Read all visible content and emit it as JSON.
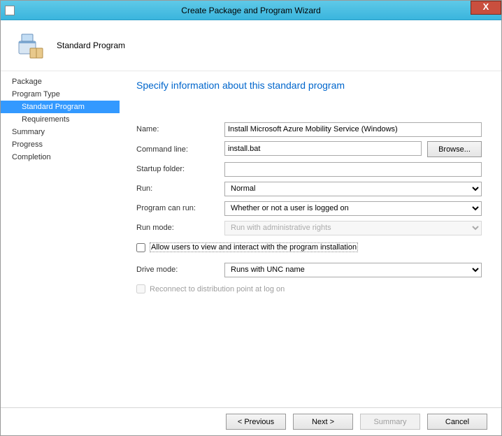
{
  "window": {
    "title": "Create Package and Program Wizard",
    "close": "X"
  },
  "header": {
    "title": "Standard Program"
  },
  "sidebar": {
    "package": "Package",
    "program_type": "Program Type",
    "standard_program": "Standard Program",
    "requirements": "Requirements",
    "summary": "Summary",
    "progress": "Progress",
    "completion": "Completion"
  },
  "main": {
    "heading": "Specify information about this standard program",
    "labels": {
      "name": "Name:",
      "command_line": "Command line:",
      "startup_folder": "Startup folder:",
      "run": "Run:",
      "program_can_run": "Program can run:",
      "run_mode": "Run mode:",
      "allow_users": "Allow users to view and interact with the program installation",
      "drive_mode": "Drive mode:",
      "reconnect": "Reconnect to distribution point at log on"
    },
    "values": {
      "name": "Install Microsoft Azure Mobility Service (Windows)",
      "command_line": "install.bat",
      "startup_folder": "",
      "run": "Normal",
      "program_can_run": "Whether or not a user is logged on",
      "run_mode": "Run with administrative rights",
      "drive_mode": "Runs with UNC name"
    },
    "buttons": {
      "browse": "Browse..."
    }
  },
  "footer": {
    "previous": "< Previous",
    "next": "Next >",
    "summary": "Summary",
    "cancel": "Cancel"
  }
}
